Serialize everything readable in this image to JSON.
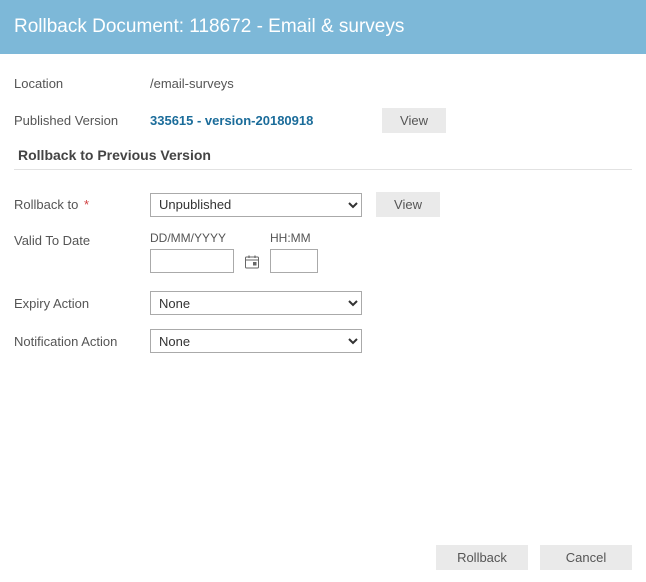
{
  "header": {
    "title": "Rollback Document: 118672 - Email & surveys"
  },
  "labels": {
    "location": "Location",
    "published_version": "Published Version",
    "section_title": "Rollback to Previous Version",
    "rollback_to": "Rollback to",
    "valid_to_date": "Valid To Date",
    "expiry_action": "Expiry Action",
    "notification_action": "Notification Action",
    "required_mark": "*",
    "date_sublabel": "DD/MM/YYYY",
    "time_sublabel": "HH:MM"
  },
  "values": {
    "location": "/email-surveys",
    "published_version": "335615 - version-20180918",
    "rollback_to_selected": "Unpublished",
    "expiry_action_selected": "None",
    "notification_action_selected": "None",
    "date_value": "",
    "time_value": ""
  },
  "buttons": {
    "view": "View",
    "rollback": "Rollback",
    "cancel": "Cancel"
  }
}
